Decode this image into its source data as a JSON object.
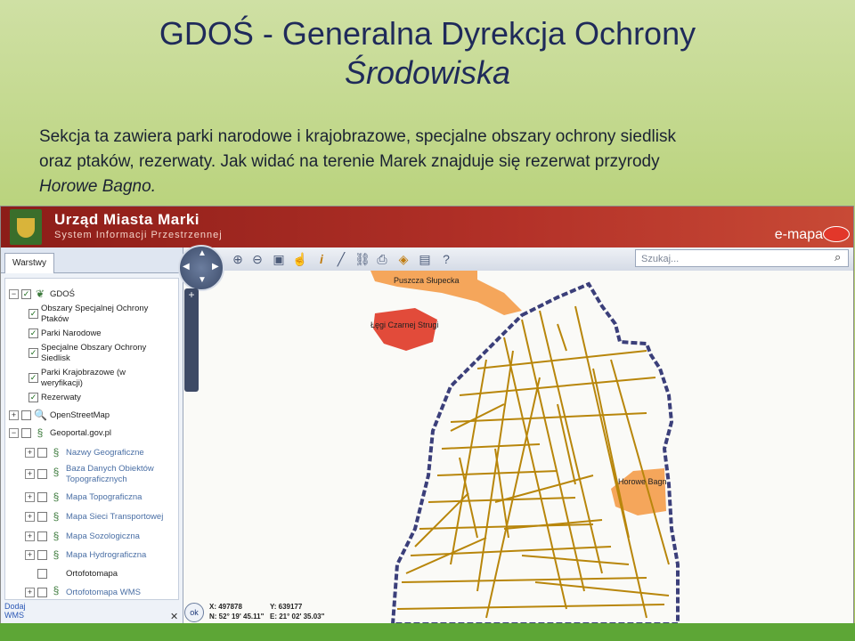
{
  "slide": {
    "title_line1": "GDOŚ - Generalna Dyrekcja Ochrony",
    "title_line2": "Środowiska",
    "body_line1": "Sekcja ta zawiera parki narodowe i krajobrazowe, specjalne obszary ochrony siedlisk",
    "body_line2": "oraz ptaków, rezerwaty. Jak widać na terenie Marek znajduje się rezerwat przyrody",
    "body_line3": "Horowe Bagno."
  },
  "app": {
    "header_title": "Urząd Miasta Marki",
    "header_subtitle": "System Informacji Przestrzennej",
    "brand": "e-mapa",
    "search_placeholder": "Szukaj...",
    "tab_label": "Warstwy",
    "footer_link_line1": "Dodaj",
    "footer_link_line2": "WMS",
    "close_symbol": "✕",
    "ok_label": "ok"
  },
  "layers": [
    {
      "label": "GDOŚ"
    },
    {
      "label_line1": "Obszary Specjalnej Ochrony",
      "label_line2": "Ptaków"
    },
    {
      "label": "Parki Narodowe"
    },
    {
      "label_line1": "Specjalne Obszary Ochrony",
      "label_line2": "Siedlisk"
    },
    {
      "label_line1": "Parki Krajobrazowe (w",
      "label_line2": "weryfikacji)"
    },
    {
      "label": "Rezerwaty"
    },
    {
      "label": "OpenStreetMap"
    },
    {
      "label": "Geoportal.gov.pl"
    },
    {
      "label": "Nazwy Geograficzne"
    },
    {
      "label_line1": "Baza Danych Obiektów",
      "label_line2": "Topograficznych"
    },
    {
      "label": "Mapa Topograficzna"
    },
    {
      "label": "Mapa Sieci Transportowej"
    },
    {
      "label": "Mapa Sozologiczna"
    },
    {
      "label": "Mapa Hydrograficzna"
    },
    {
      "label": "Ortofotomapa"
    },
    {
      "label": "Ortofotomapa WMS"
    }
  ],
  "map": {
    "label_puszcza": "Puszcza Słupecka",
    "label_legi": "Łęgi Czarnej Strugi",
    "label_horowe": "Horowe Bagn",
    "coords": {
      "x": "X: 497878",
      "y": "Y: 639177",
      "n": "N: 52° 19' 45.11\"",
      "e": "E: 21° 02' 35.03\""
    }
  },
  "colors": {
    "header_red": "#b33128",
    "roads": "#b8860b",
    "reserve_orange": "#f5a65b",
    "reserve_red": "#e24b3a",
    "boundary": "#3b3f7a"
  }
}
